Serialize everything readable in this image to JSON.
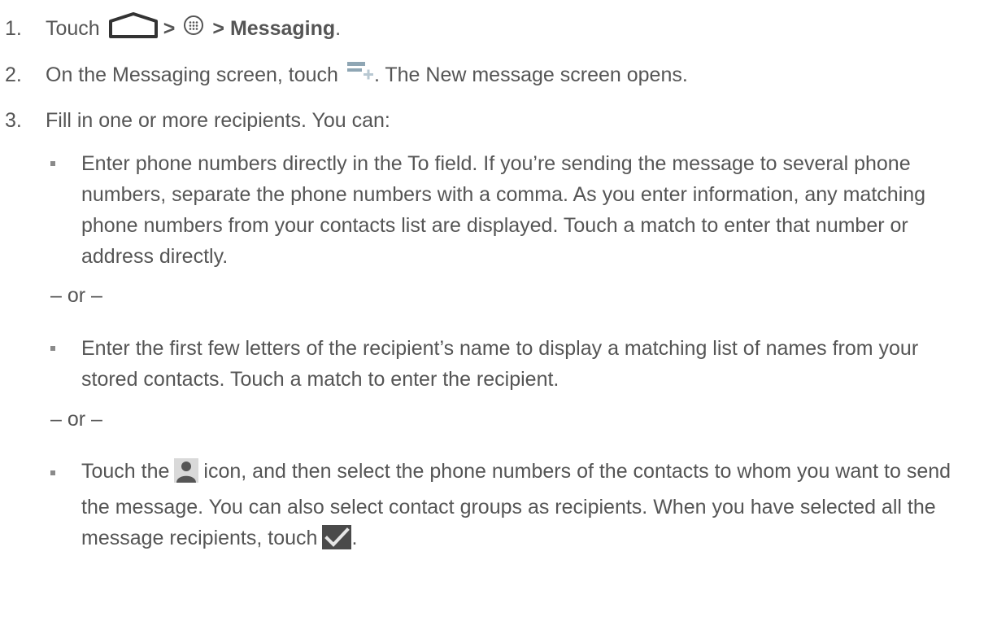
{
  "steps": [
    {
      "num": "1.",
      "prefix": "Touch",
      "sep1": ">",
      "sep2": ">",
      "bold": "Messaging",
      "suffix": "."
    },
    {
      "num": "2.",
      "before": "On the Messaging screen, touch",
      "after": ". The New message screen opens."
    },
    {
      "num": "3.",
      "text": "Fill in one or more recipients. You can:"
    }
  ],
  "bullets": [
    {
      "text": "Enter phone numbers directly in the To field. If you’re sending the message to several phone numbers, separate the phone numbers with a comma. As you enter information, any matching phone numbers from your contacts list are displayed. Touch a match to enter that number or address directly."
    },
    {
      "text": "Enter the first few letters of the recipient’s name to display a matching list of names from your stored contacts. Touch a match to enter the recipient."
    },
    {
      "before": "Touch the",
      "middle": "icon, and then select the phone numbers of the contacts to whom you want to send the message. You can also select contact groups as recipients. When you have selected all the message recipients, touch",
      "after": "."
    }
  ],
  "separators": {
    "or": "– or –"
  },
  "icons": {
    "home": "home-icon",
    "apps": "apps-icon",
    "compose": "compose-message-icon",
    "contact": "contact-person-icon",
    "check": "checkmark-icon"
  }
}
